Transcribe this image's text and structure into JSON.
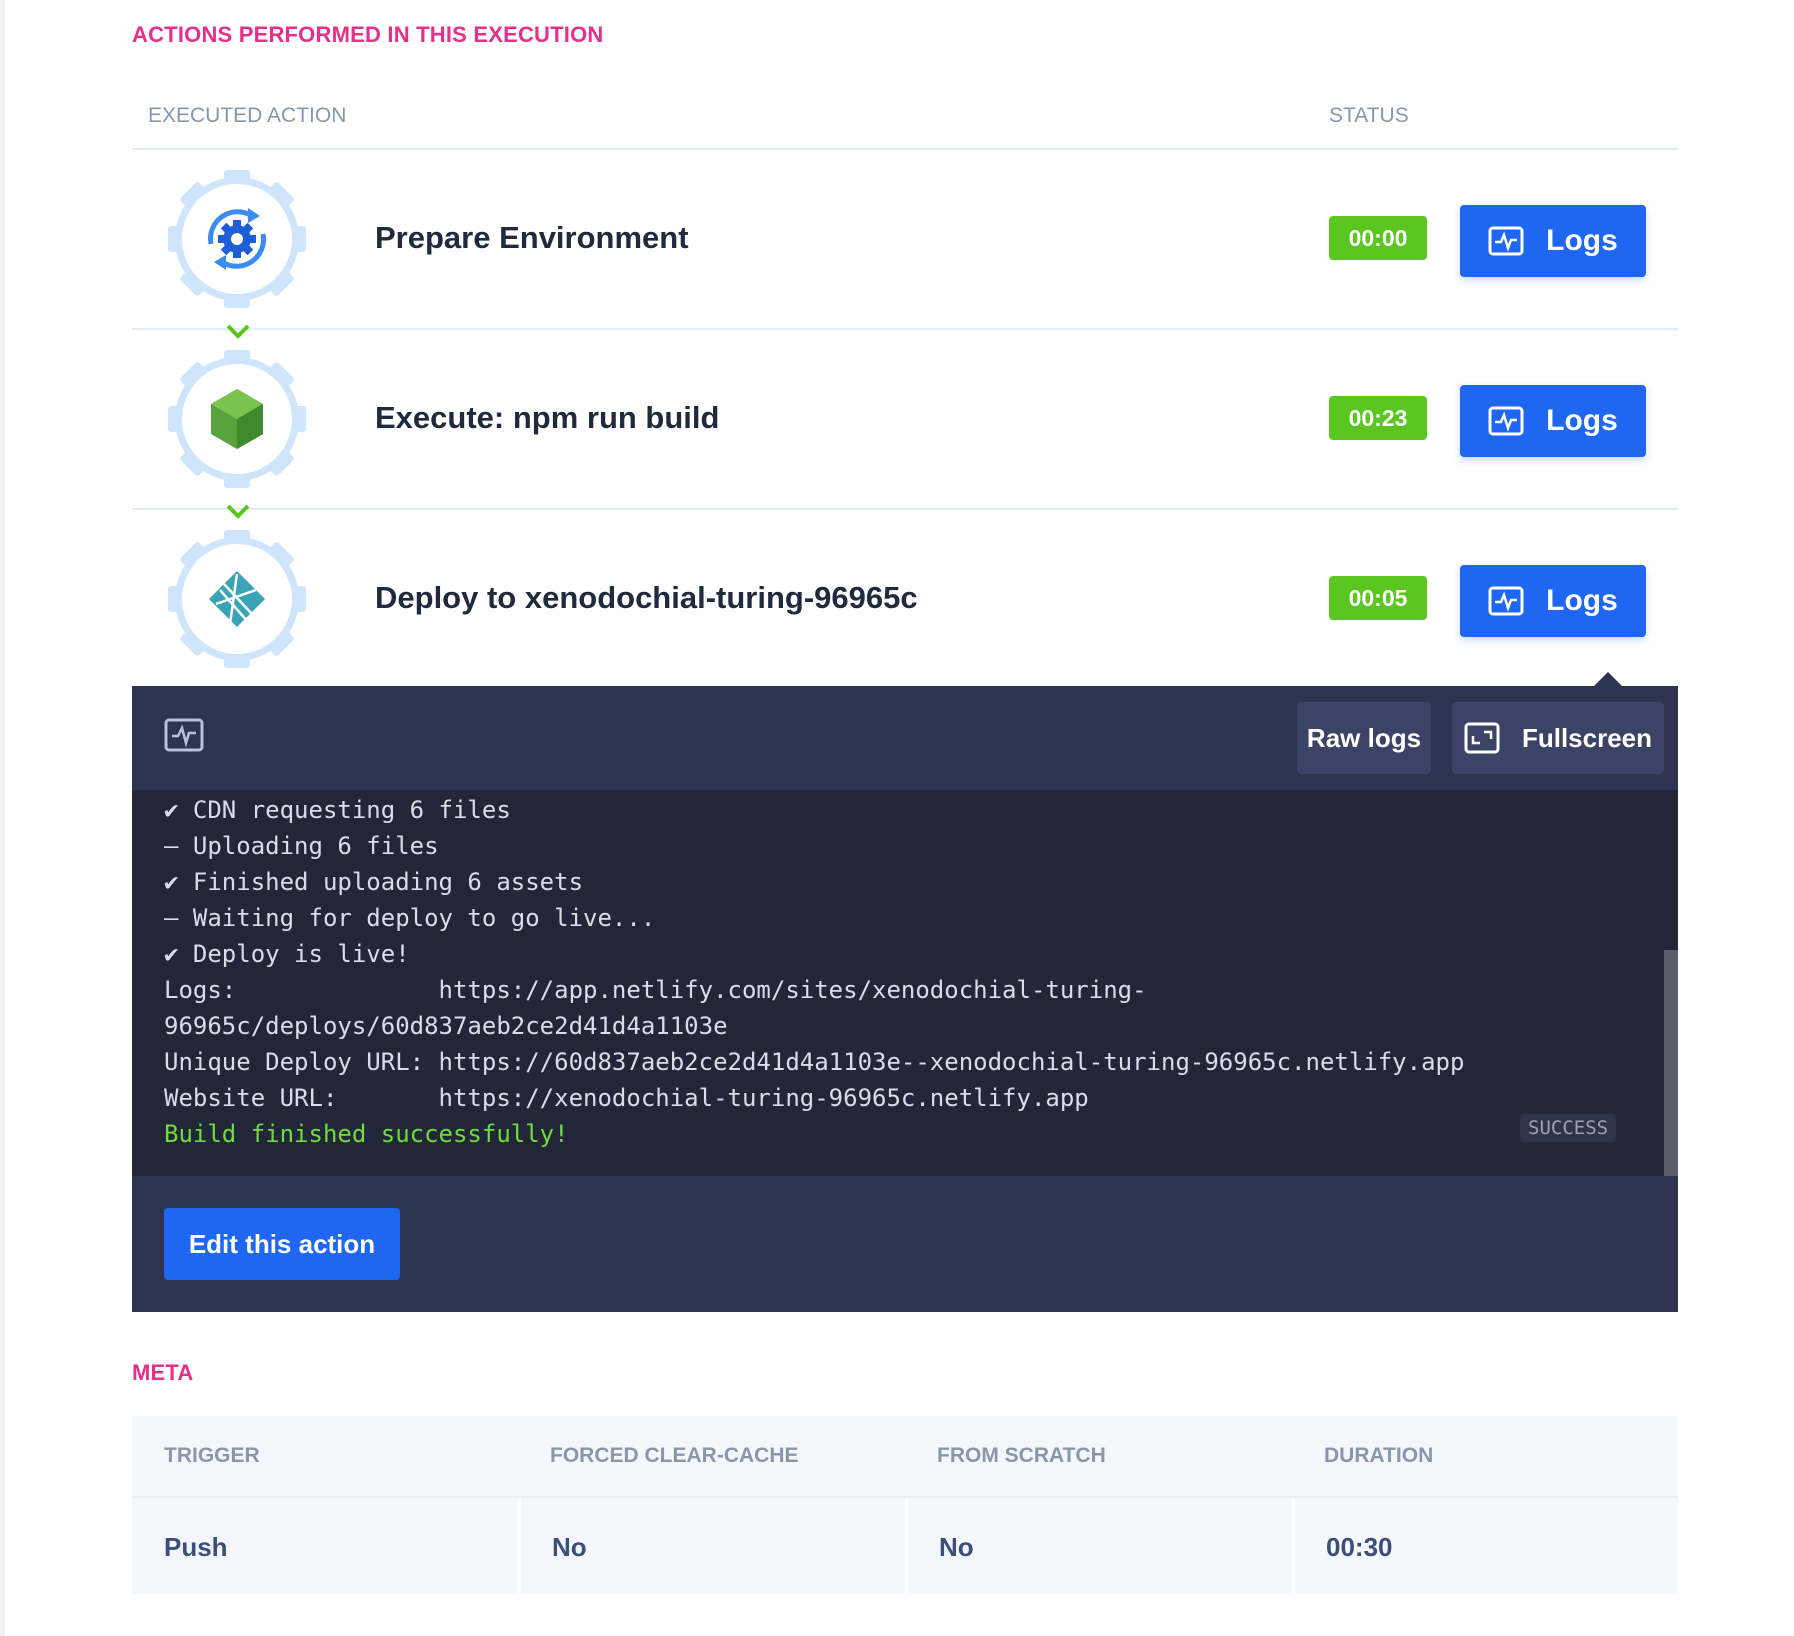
{
  "sections": {
    "actions_title": "ACTIONS PERFORMED IN THIS EXECUTION",
    "meta_title": "META"
  },
  "actions_table": {
    "col_action": "EXECUTED ACTION",
    "col_status": "STATUS",
    "logs_label": "Logs",
    "rows": [
      {
        "title": "Prepare Environment",
        "status": "00:00",
        "icon": "gear-sync-icon"
      },
      {
        "title": "Execute: npm run build",
        "status": "00:23",
        "icon": "nodejs-hexagon-icon"
      },
      {
        "title": "Deploy to xenodochial-turing-96965c",
        "status": "00:05",
        "icon": "netlify-icon"
      }
    ]
  },
  "log_panel": {
    "raw_logs_label": "Raw logs",
    "fullscreen_label": "Fullscreen",
    "lines": [
      "✔ CDN requesting 6 files",
      "– Uploading 6 files",
      "✔ Finished uploading 6 assets",
      "– Waiting for deploy to go live...",
      "✔ Deploy is live!",
      "Logs:              https://app.netlify.com/sites/xenodochial-turing-",
      "96965c/deploys/60d837aeb2ce2d41d4a1103e",
      "Unique Deploy URL: https://60d837aeb2ce2d41d4a1103e--xenodochial-turing-96965c.netlify.app",
      "Website URL:       https://xenodochial-turing-96965c.netlify.app",
      "Build finished successfully!"
    ],
    "success_tag": "SUCCESS",
    "edit_action_label": "Edit this action"
  },
  "meta": {
    "headers": [
      "TRIGGER",
      "FORCED CLEAR-CACHE",
      "FROM SCRATCH",
      "DURATION"
    ],
    "values": [
      "Push",
      "No",
      "No",
      "00:30"
    ]
  },
  "colors": {
    "accent_pink": "#e6308a",
    "primary_blue": "#1f66f2",
    "status_green": "#5ac61f",
    "log_bg": "#212738",
    "panel_bg": "#2c3451"
  }
}
